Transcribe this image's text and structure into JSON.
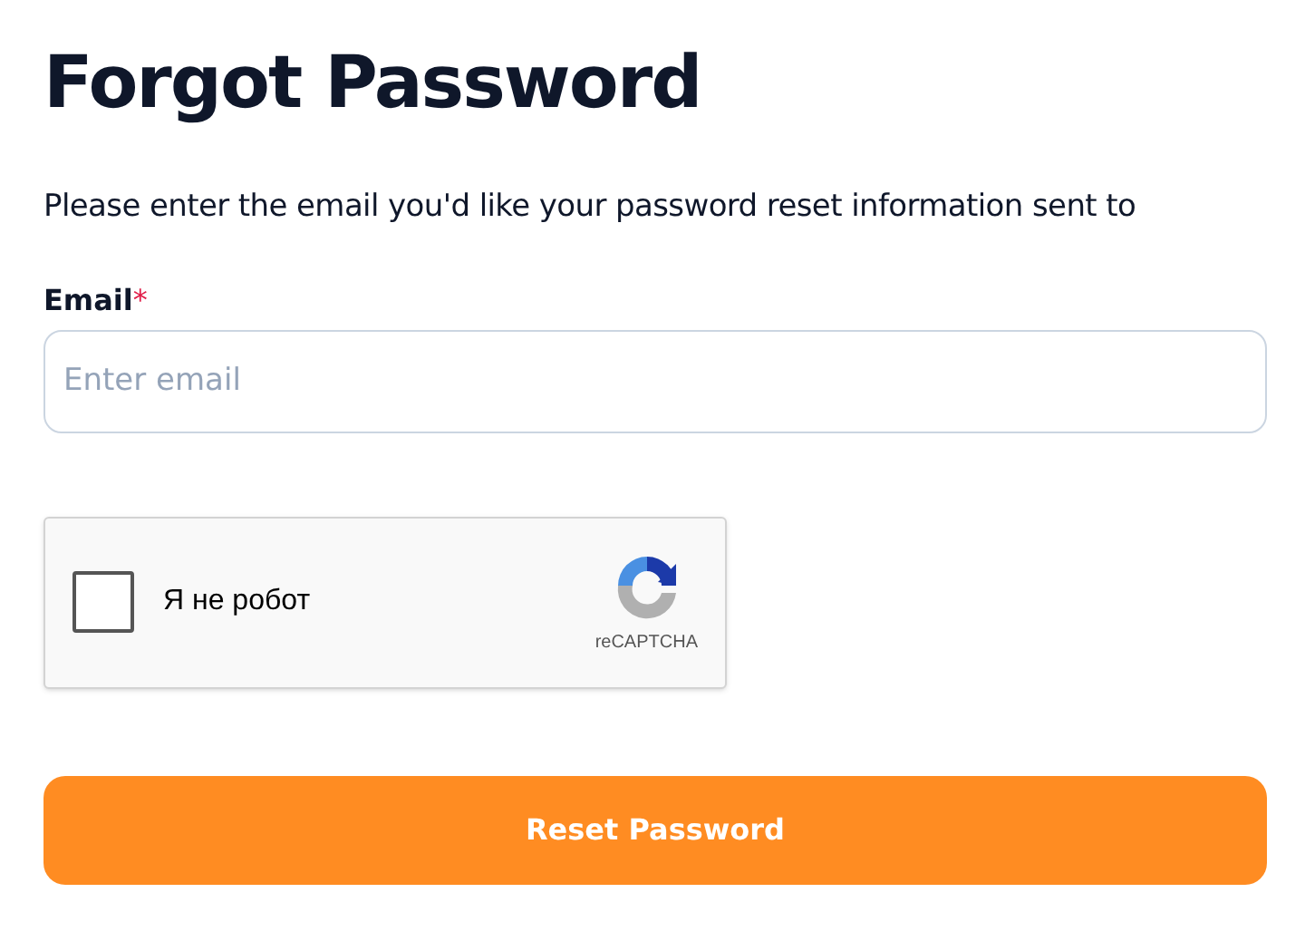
{
  "title": "Forgot Password",
  "description": "Please enter the email you'd like your password reset information sent to",
  "email": {
    "label": "Email",
    "required_mark": "*",
    "placeholder": "Enter email"
  },
  "captcha": {
    "label": "Я не робот",
    "checked": false,
    "brand": "reCAPTCHA"
  },
  "submit": {
    "label": "Reset Password"
  }
}
